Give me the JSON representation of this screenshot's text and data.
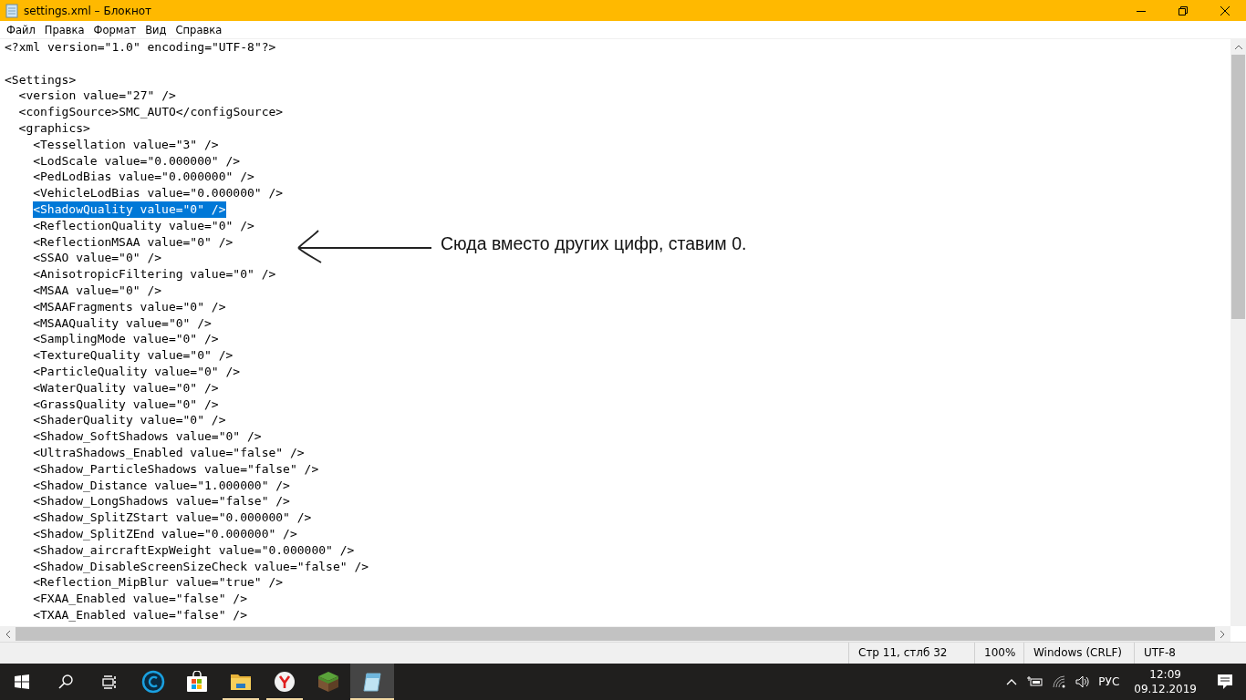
{
  "window": {
    "title": "settings.xml – Блокнот"
  },
  "menu": [
    "Файл",
    "Правка",
    "Формат",
    "Вид",
    "Справка"
  ],
  "document": [
    {
      "kind": "code",
      "text": "<?xml version=\"1.0\" encoding=\"UTF-8\"?>",
      "selected": false
    },
    {
      "kind": "blank"
    },
    {
      "kind": "code",
      "text": "<Settings>",
      "selected": false,
      "children": [
        {
          "text": "<version value=\"27\" />",
          "selected": false
        },
        {
          "text": "<configSource>SMC_AUTO</configSource>",
          "selected": false
        },
        {
          "text": "<graphics>",
          "selected": false,
          "children": [
            {
              "text": "<Tessellation value=\"3\" />",
              "selected": false
            },
            {
              "text": "<LodScale value=\"0.000000\" />",
              "selected": false
            },
            {
              "text": "<PedLodBias value=\"0.000000\" />",
              "selected": false
            },
            {
              "text": "<VehicleLodBias value=\"0.000000\" />",
              "selected": false
            },
            {
              "text": "<ShadowQuality value=\"0\" />",
              "selected": true
            },
            {
              "text": "<ReflectionQuality value=\"0\" />",
              "selected": false
            },
            {
              "text": "<ReflectionMSAA value=\"0\" />",
              "selected": false
            },
            {
              "text": "<SSAO value=\"0\" />",
              "selected": false
            },
            {
              "text": "<AnisotropicFiltering value=\"0\" />",
              "selected": false
            },
            {
              "text": "<MSAA value=\"0\" />",
              "selected": false
            },
            {
              "text": "<MSAAFragments value=\"0\" />",
              "selected": false
            },
            {
              "text": "<MSAAQuality value=\"0\" />",
              "selected": false
            },
            {
              "text": "<SamplingMode value=\"0\" />",
              "selected": false
            },
            {
              "text": "<TextureQuality value=\"0\" />",
              "selected": false
            },
            {
              "text": "<ParticleQuality value=\"0\" />",
              "selected": false
            },
            {
              "text": "<WaterQuality value=\"0\" />",
              "selected": false
            },
            {
              "text": "<GrassQuality value=\"0\" />",
              "selected": false
            },
            {
              "text": "<ShaderQuality value=\"0\" />",
              "selected": false
            },
            {
              "text": "<Shadow_SoftShadows value=\"0\" />",
              "selected": false
            },
            {
              "text": "<UltraShadows_Enabled value=\"false\" />",
              "selected": false
            },
            {
              "text": "<Shadow_ParticleShadows value=\"false\" />",
              "selected": false
            },
            {
              "text": "<Shadow_Distance value=\"1.000000\" />",
              "selected": false
            },
            {
              "text": "<Shadow_LongShadows value=\"false\" />",
              "selected": false
            },
            {
              "text": "<Shadow_SplitZStart value=\"0.000000\" />",
              "selected": false
            },
            {
              "text": "<Shadow_SplitZEnd value=\"0.000000\" />",
              "selected": false
            },
            {
              "text": "<Shadow_aircraftExpWeight value=\"0.000000\" />",
              "selected": false
            },
            {
              "text": "<Shadow_DisableScreenSizeCheck value=\"false\" />",
              "selected": false
            },
            {
              "text": "<Reflection_MipBlur value=\"true\" />",
              "selected": false
            },
            {
              "text": "<FXAA_Enabled value=\"false\" />",
              "selected": false
            },
            {
              "text": "<TXAA_Enabled value=\"false\" />",
              "selected": false
            }
          ]
        }
      ]
    }
  ],
  "annotation": {
    "text": "Сюда вместо других цифр, ставим 0."
  },
  "status_bar": [
    "Стр 11, стлб 32",
    "100%",
    "Windows (CRLF)",
    "UTF-8"
  ],
  "taskbar": {
    "apps": [
      {
        "kind": "circle-c",
        "running": false,
        "selected": false
      },
      {
        "kind": "store",
        "running": false,
        "selected": false
      },
      {
        "kind": "folder",
        "running": true,
        "selected": false
      },
      {
        "kind": "browser",
        "running": true,
        "selected": false
      },
      {
        "kind": "block",
        "running": false,
        "selected": false
      },
      {
        "kind": "notepad",
        "running": true,
        "selected": true
      }
    ],
    "language": "РУС",
    "time": "12:09",
    "date": "09.12.2019"
  }
}
